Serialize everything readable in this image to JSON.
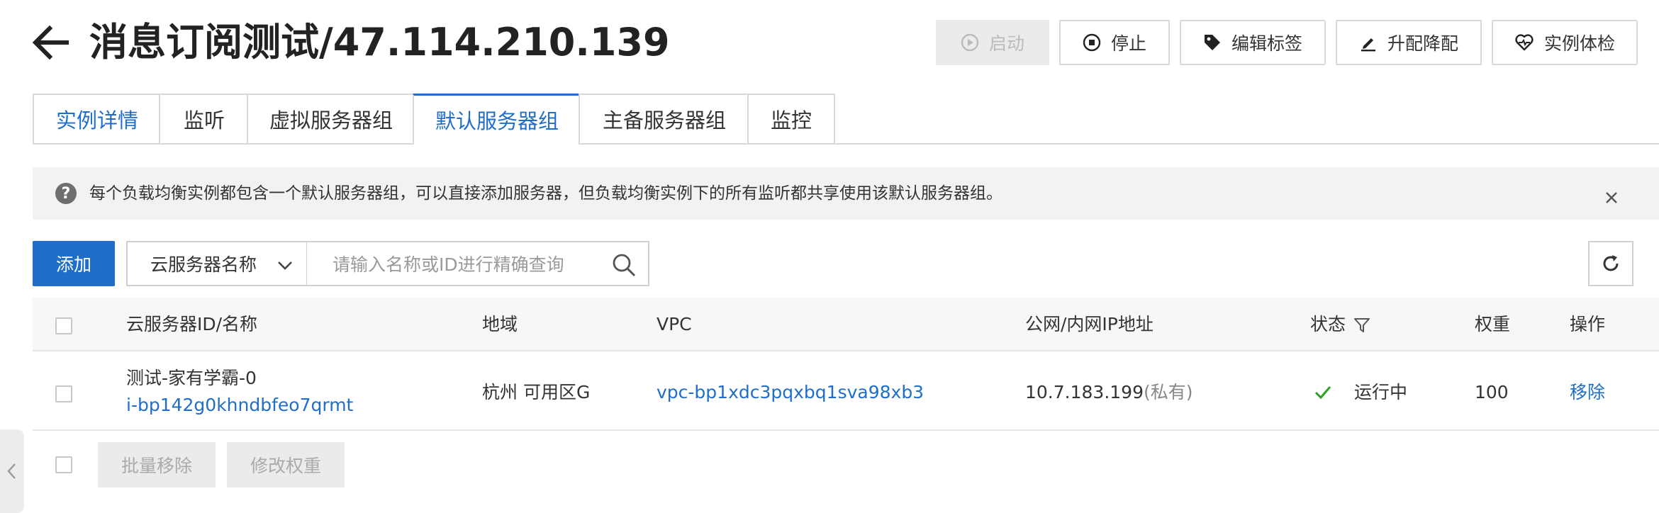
{
  "header": {
    "title": "消息订阅测试/47.114.210.139",
    "back_icon": "arrow-left-icon",
    "buttons": [
      {
        "label": "启动",
        "icon": "play-circle-icon",
        "disabled": true
      },
      {
        "label": "停止",
        "icon": "stop-circle-icon",
        "disabled": false
      },
      {
        "label": "编辑标签",
        "icon": "tag-icon",
        "disabled": false
      },
      {
        "label": "升配降配",
        "icon": "edit-pen-icon",
        "disabled": false
      },
      {
        "label": "实例体检",
        "icon": "heart-pulse-icon",
        "disabled": false
      }
    ]
  },
  "tabs": [
    {
      "label": "实例详情"
    },
    {
      "label": "监听"
    },
    {
      "label": "虚拟服务器组"
    },
    {
      "label": "默认服务器组",
      "active": true
    },
    {
      "label": "主备服务器组"
    },
    {
      "label": "监控"
    }
  ],
  "notice": {
    "text": "每个负载均衡实例都包含一个默认服务器组，可以直接添加服务器，但负载均衡实例下的所有监听都共享使用该默认服务器组。",
    "icon": "question-circle-icon",
    "close_icon": "close-icon"
  },
  "toolbar": {
    "add_label": "添加",
    "filter_select": "云服务器名称",
    "search_placeholder": "请输入名称或ID进行精确查询",
    "search_icon": "search-icon",
    "refresh_icon": "refresh-icon"
  },
  "table": {
    "columns": {
      "instance": "云服务器ID/名称",
      "region": "地域",
      "vpc": "VPC",
      "ip": "公网/内网IP地址",
      "status": "状态",
      "weight": "权重",
      "action": "操作"
    },
    "rows": [
      {
        "name": "测试-家有学霸-0",
        "id": "i-bp142g0khndbfeo7qrmt",
        "region": "杭州 可用区G",
        "vpc": "vpc-bp1xdc3pqxbq1sva98xb3",
        "ip": "10.7.183.199",
        "ip_type": "(私有)",
        "status": "运行中",
        "weight": "100",
        "action": "移除"
      }
    ]
  },
  "footer": {
    "batch_remove": "批量移除",
    "modify_weight": "修改权重"
  },
  "colors": {
    "primary": "#1f6ec8",
    "success": "#2ea121"
  }
}
